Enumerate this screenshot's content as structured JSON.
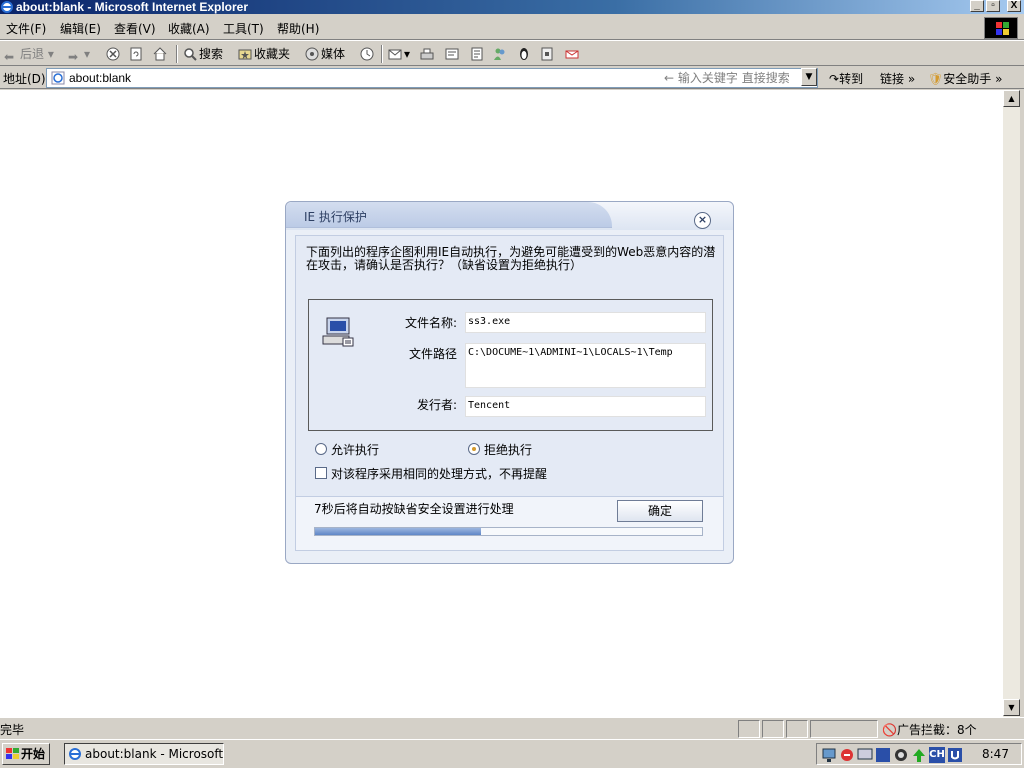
{
  "window": {
    "title": "about:blank - Microsoft Internet Explorer",
    "min": "_",
    "max": "▫",
    "close": "X"
  },
  "menu": [
    "文件(F)",
    "编辑(E)",
    "查看(V)",
    "收藏(A)",
    "工具(T)",
    "帮助(H)"
  ],
  "toolbar": {
    "back": "后退",
    "search": "搜索",
    "favorites": "收藏夹",
    "media": "媒体"
  },
  "address": {
    "label": "地址(D)",
    "url": "about:blank",
    "search_hint": "输入关键字 直接搜索",
    "go": "转到",
    "links": "链接",
    "assistant": "安全助手"
  },
  "dialog": {
    "title": "IE 执行保护",
    "message": "下面列出的程序企图利用IE自动执行，为避免可能遭受到的Web恶意内容的潜在攻击，请确认是否执行？（缺省设置为拒绝执行）",
    "file_name_label": "文件名称:",
    "file_name": "ss3.exe",
    "file_path_label": "文件路径",
    "file_path": "C:\\DOCUME~1\\ADMINI~1\\LOCALS~1\\Temp",
    "publisher_label": "发行者:",
    "publisher": "Tencent",
    "allow_label": "允许执行",
    "deny_label": "拒绝执行",
    "selected": "deny",
    "remember_label": "对该程序采用相同的处理方式，不再提醒",
    "remember_checked": false,
    "countdown": "7秒后将自动按缺省安全设置进行处理",
    "ok_label": "确定",
    "progress": 0.43
  },
  "status": {
    "text": "完毕",
    "adblock": "广告拦截：8个"
  },
  "taskbar": {
    "start": "开始",
    "task": "about:blank - Microsoft In...",
    "clock": "8:47"
  },
  "colors": {
    "titlebar": "#0a246a",
    "dialog_bg": "#eaeff7",
    "progress": "#5f86c6"
  }
}
